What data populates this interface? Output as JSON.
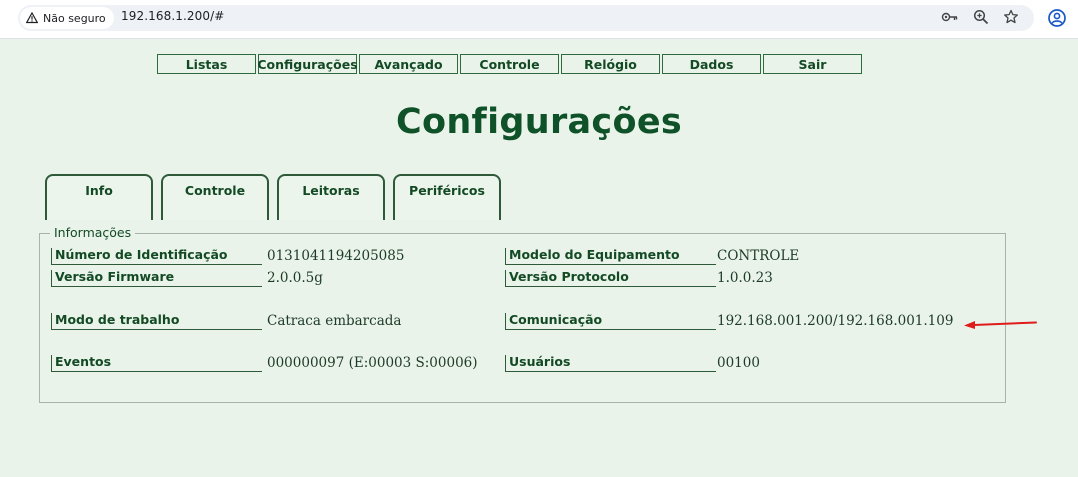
{
  "browser": {
    "security_label": "Não seguro",
    "url": "192.168.1.200/#",
    "icons": [
      "warning-icon",
      "password-key-icon",
      "zoom-icon",
      "bookmark-star-icon",
      "profile-icon"
    ]
  },
  "nav": {
    "items": [
      "Listas",
      "Configurações",
      "Avançado",
      "Controle",
      "Relógio",
      "Dados",
      "Sair"
    ]
  },
  "page": {
    "title": "Configurações"
  },
  "tabs": [
    "Info",
    "Controle",
    "Leitoras",
    "Periféricos"
  ],
  "info": {
    "legend": "Informações",
    "fields": [
      {
        "label": "Número de Identificação",
        "value": "0131041194205085"
      },
      {
        "label": "Versão Firmware",
        "value": "2.0.0.5g"
      },
      {
        "label": "Modo de trabalho",
        "value": "Catraca embarcada"
      },
      {
        "label": "Eventos",
        "value": "000000097 (E:00003 S:00006)"
      },
      {
        "label": "Modelo do Equipamento",
        "value": "CONTROLE"
      },
      {
        "label": "Versão Protocolo",
        "value": "1.0.0.23"
      },
      {
        "label": "Comunicação",
        "value": "192.168.001.200/192.168.001.109"
      },
      {
        "label": "Usuários",
        "value": "00100"
      }
    ]
  },
  "colors": {
    "page_background": "#e9f3ea",
    "title_green": "#0f5128",
    "border_green": "#2f5a3a",
    "arrow_red": "#e01b1b"
  }
}
